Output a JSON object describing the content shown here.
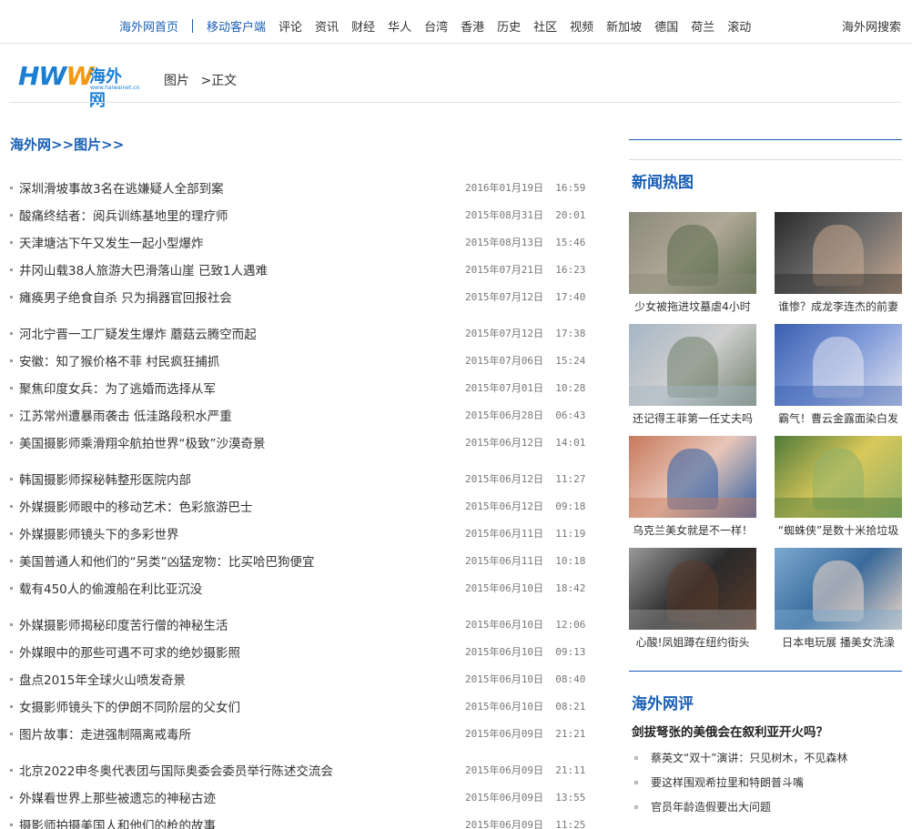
{
  "topnav": {
    "home": "海外网首页",
    "mobile": "移动客户端",
    "items": [
      "评论",
      "资讯",
      "财经",
      "华人",
      "台湾",
      "香港",
      "历史",
      "社区",
      "视频",
      "新加坡",
      "德国",
      "荷兰",
      "滚动"
    ],
    "search": "海外网搜索"
  },
  "logo": {
    "letters_a": "HW",
    "letters_b": "W",
    "cn": "海外网",
    "url": "www.haiwainet.cn"
  },
  "breadcrumb_top": {
    "a": "图片",
    "sep": ">",
    "b": "正文"
  },
  "section_title": {
    "a": "海外网",
    "sep1": ">>",
    "b": "图片",
    "sep2": ">>"
  },
  "articles": [
    [
      {
        "title": "深圳滑坡事故3名在逃嫌疑人全部到案",
        "date": "2016年01月19日",
        "time": "16:59"
      },
      {
        "title": "酸痛终结者：阅兵训练基地里的理疗师",
        "date": "2015年08月31日",
        "time": "20:01"
      },
      {
        "title": "天津塘沽下午又发生一起小型爆炸",
        "date": "2015年08月13日",
        "time": "15:46"
      },
      {
        "title": "井冈山载38人旅游大巴滑落山崖 已致1人遇难",
        "date": "2015年07月21日",
        "time": "16:23"
      },
      {
        "title": "瘫痪男子绝食自杀 只为捐器官回报社会",
        "date": "2015年07月12日",
        "time": "17:40"
      }
    ],
    [
      {
        "title": "河北宁晋一工厂疑发生爆炸 蘑菇云腾空而起",
        "date": "2015年07月12日",
        "time": "17:38"
      },
      {
        "title": "安徽：知了猴价格不菲 村民疯狂捕抓",
        "date": "2015年07月06日",
        "time": "15:24"
      },
      {
        "title": "聚焦印度女兵：为了逃婚而选择从军",
        "date": "2015年07月01日",
        "time": "10:28"
      },
      {
        "title": "江苏常州遭暴雨袭击 低洼路段积水严重",
        "date": "2015年06月28日",
        "time": "06:43"
      },
      {
        "title": "美国摄影师乘滑翔伞航拍世界“极致”沙漠奇景",
        "date": "2015年06月12日",
        "time": "14:01"
      }
    ],
    [
      {
        "title": "韩国摄影师探秘韩整形医院内部",
        "date": "2015年06月12日",
        "time": "11:27"
      },
      {
        "title": "外媒摄影师眼中的移动艺术：色彩旅游巴士",
        "date": "2015年06月12日",
        "time": "09:18"
      },
      {
        "title": "外媒摄影师镜头下的多彩世界",
        "date": "2015年06月11日",
        "time": "11:19"
      },
      {
        "title": "美国普通人和他们的“另类”凶猛宠物：比买哈巴狗便宜",
        "date": "2015年06月11日",
        "time": "10:18"
      },
      {
        "title": "载有450人的偷渡船在利比亚沉没",
        "date": "2015年06月10日",
        "time": "18:42"
      }
    ],
    [
      {
        "title": "外媒摄影师揭秘印度苦行僧的神秘生活",
        "date": "2015年06月10日",
        "time": "12:06"
      },
      {
        "title": "外媒眼中的那些可遇不可求的绝妙摄影照",
        "date": "2015年06月10日",
        "time": "09:13"
      },
      {
        "title": "盘点2015年全球火山喷发奇景",
        "date": "2015年06月10日",
        "time": "08:40"
      },
      {
        "title": "女摄影师镜头下的伊朗不同阶层的父女们",
        "date": "2015年06月10日",
        "time": "08:21"
      },
      {
        "title": "图片故事：走进强制隔离戒毒所",
        "date": "2015年06月09日",
        "time": "21:21"
      }
    ],
    [
      {
        "title": "北京2022申冬奥代表团与国际奥委会委员举行陈述交流会",
        "date": "2015年06月09日",
        "time": "21:11"
      },
      {
        "title": "外媒看世界上那些被遗忘的神秘古迹",
        "date": "2015年06月09日",
        "time": "13:55"
      },
      {
        "title": "摄影师拍摄美国人和他们的枪的故事",
        "date": "2015年06月09日",
        "time": "11:25"
      }
    ]
  ],
  "hotpics": {
    "title": "新闻热图",
    "items": [
      {
        "caption": "少女被拖进坟墓虐4小时",
        "palette": [
          "#8a8a7a",
          "#5b6b4a",
          "#b0a898"
        ]
      },
      {
        "caption": "谁惨？成龙李连杰的前妻",
        "palette": [
          "#2a2a2a",
          "#c9a98f",
          "#6b6b6b"
        ]
      },
      {
        "caption": "还记得王菲第一任丈夫吗",
        "palette": [
          "#a5b6c5",
          "#6f7f6a",
          "#cfcfcf"
        ]
      },
      {
        "caption": "霸气！曹云金露面染白发",
        "palette": [
          "#3a5fb0",
          "#e5e5f0",
          "#7f9ad8"
        ]
      },
      {
        "caption": "乌克兰美女就是不一样！",
        "palette": [
          "#c77a5c",
          "#2d5fa5",
          "#e8c6b8"
        ]
      },
      {
        "caption": "“蜘蛛侠”是数十米拾垃圾",
        "palette": [
          "#4f7a3a",
          "#8fb06a",
          "#d9c85a"
        ]
      },
      {
        "caption": "心酸!凤姐蹲在纽约街头",
        "palette": [
          "#9a9a9a",
          "#5a3a2a",
          "#2a2a2a"
        ]
      },
      {
        "caption": "日本电玩展 播美女洗澡",
        "palette": [
          "#7aaad0",
          "#f0d8c8",
          "#3a6a9a"
        ]
      }
    ]
  },
  "comment": {
    "title": "海外网评",
    "headline": "剑拔弩张的美俄会在叙利亚开火吗？",
    "items": [
      "蔡英文“双十”演讲：只见树木，不见森林",
      "要这样围观希拉里和特朗普斗嘴",
      "官员年龄造假要出大问题"
    ]
  }
}
